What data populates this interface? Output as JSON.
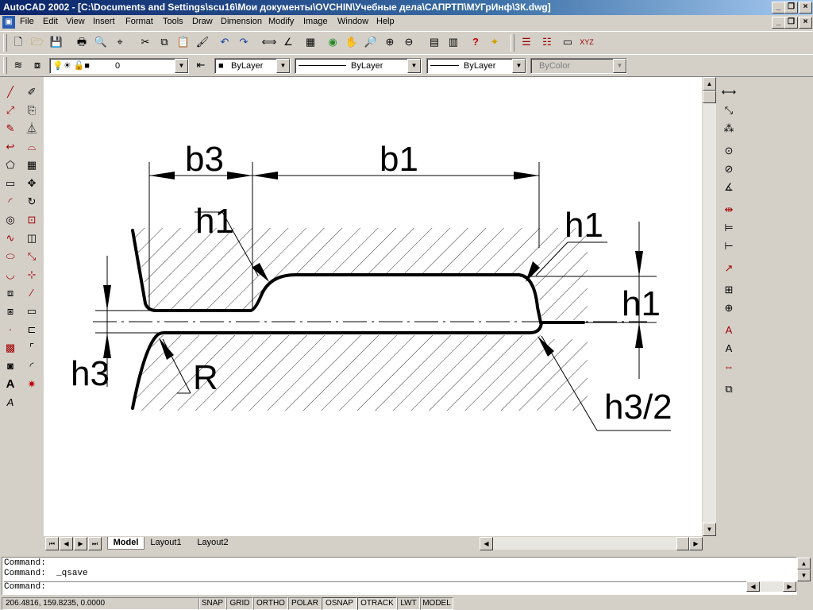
{
  "window": {
    "title": "AutoCAD 2002 - [C:\\Documents and Settings\\scu16\\Мои документы\\OVCHIN\\Учебные дела\\САПРТП\\МУГрИнф\\3К.dwg]"
  },
  "menu": [
    "File",
    "Edit",
    "View",
    "Insert",
    "Format",
    "Tools",
    "Draw",
    "Dimension",
    "Modify",
    "Image",
    "Window",
    "Help"
  ],
  "properties_bar": {
    "layer": "0",
    "color": "ByLayer",
    "linetype": "ByLayer",
    "lineweight": "ByLayer",
    "plotstyle": "ByColor"
  },
  "drawing": {
    "labels": {
      "b3": "b3",
      "b1": "b1",
      "h1_left": "h1",
      "h1_right": "h1",
      "h1_dim": "h1",
      "h3": "h3",
      "R": "R",
      "h3_half": "h3/2"
    }
  },
  "tabs": [
    "Model",
    "Layout1",
    "Layout2"
  ],
  "active_tab": "Model",
  "command_lines": [
    "Command:",
    "Command:  _qsave",
    "Command:"
  ],
  "status": {
    "coords": "206.4816, 159.8235, 0.0000",
    "toggles": [
      "SNAP",
      "GRID",
      "ORTHO",
      "POLAR",
      "OSNAP",
      "OTRACK",
      "LWT",
      "MODEL"
    ]
  },
  "icons": {
    "standard": [
      "new-icon",
      "open-icon",
      "save-icon",
      "print-icon",
      "print-preview-icon",
      "publish-icon",
      "cut-icon",
      "copy-icon",
      "paste-icon",
      "match-properties-icon",
      "undo-icon",
      "redo-icon",
      "distance-icon",
      "ucs-icon",
      "pan-icon",
      "zoom-realtime-icon",
      "zoom-window-icon",
      "zoom-previous-icon",
      "properties-icon",
      "design-center-icon",
      "help-icon"
    ]
  }
}
